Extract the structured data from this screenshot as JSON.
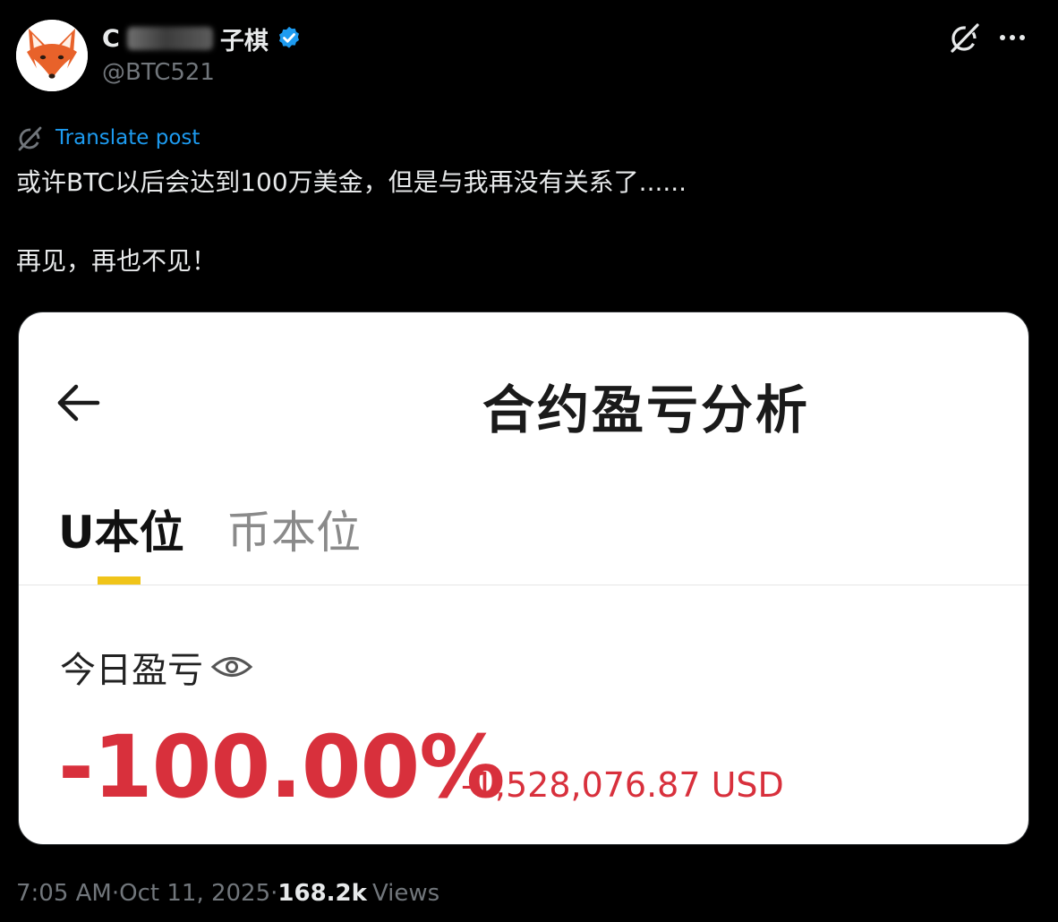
{
  "author": {
    "display_name_visible": "C",
    "display_name_suffix": "子棋",
    "handle": "@BTC521",
    "avatar_icon": "fox-avatar-icon",
    "verified_icon": "verified-badge-icon"
  },
  "header_actions": {
    "grok_icon": "grok-icon",
    "more_icon": "more-icon",
    "more_label": "···"
  },
  "translate": {
    "label": "Translate post",
    "icon": "translate-icon"
  },
  "post": {
    "line1": "或许BTC以后会达到100万美金，但是与我再没有关系了......",
    "line2": "再见，再也不见！"
  },
  "media": {
    "back_icon": "back-arrow-icon",
    "title": "合约盈亏分析",
    "tabs": [
      {
        "label": "U本位",
        "active": true
      },
      {
        "label": "币本位",
        "active": false
      }
    ],
    "pnl_label": "今日盈亏",
    "eye_icon": "eye-icon",
    "pnl_percent": "-100.00%",
    "pnl_amount": "-1,528,076.87 USD",
    "colors": {
      "loss_red": "#d8303c",
      "indicator_yellow": "#f0c419"
    }
  },
  "meta": {
    "time": "7:05 AM",
    "separator": " · ",
    "date": "Oct 11, 2025",
    "views_count": "168.2k",
    "views_label": "Views"
  },
  "colors": {
    "background": "#000000",
    "text_primary": "#e7e9ea",
    "text_secondary": "#71767b",
    "link_blue": "#1d9bf0"
  }
}
